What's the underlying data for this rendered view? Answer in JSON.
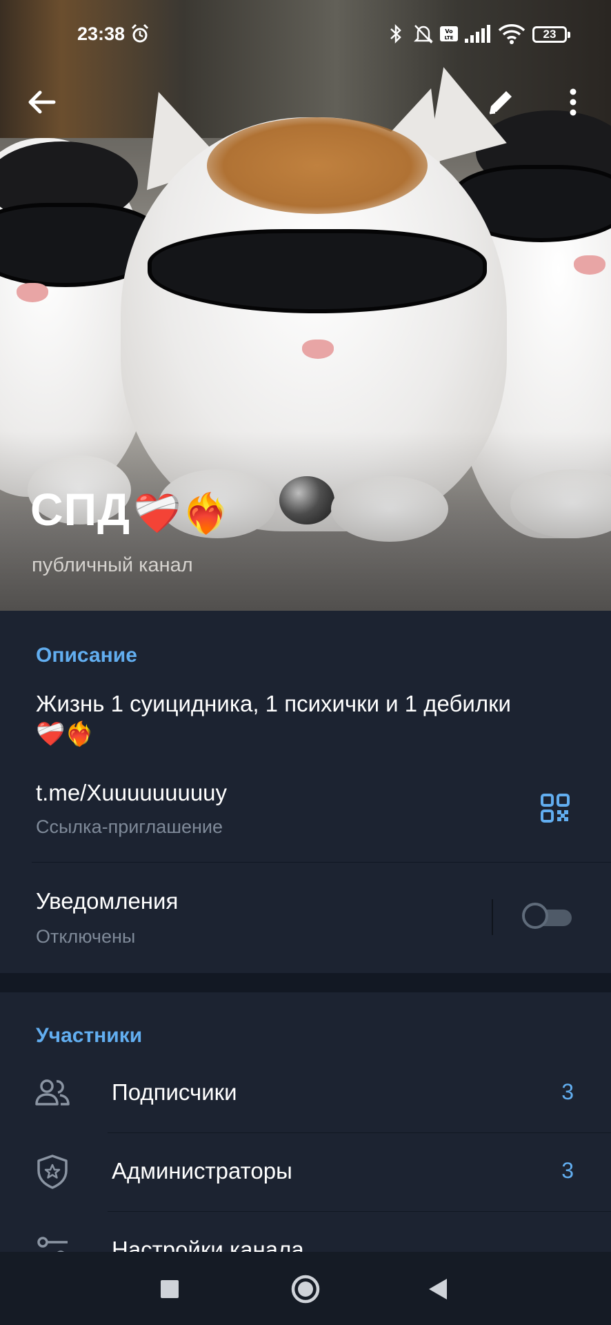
{
  "status_bar": {
    "time": "23:38",
    "alarm_icon": "alarm-clock-icon",
    "battery": "23",
    "icons": [
      "bluetooth-icon",
      "notifications-off-icon",
      "volte-icon",
      "signal-icon",
      "wifi-icon"
    ]
  },
  "toolbar": {
    "back_icon": "arrow-left-icon",
    "edit_icon": "pencil-icon",
    "more_icon": "more-vertical-icon"
  },
  "channel": {
    "name": "СПД",
    "title_emojis": "❤️‍🩹❤️‍🔥",
    "type": "публичный канал"
  },
  "info": {
    "description_label": "Описание",
    "description": "Жизнь 1 суицидника, 1 психички и 1 дебилки",
    "description_emojis": "❤️‍🩹❤️‍🔥",
    "link": "t.me/Xuuuuuuuuuy",
    "link_sub": "Ссылка-приглашение",
    "notifications_label": "Уведомления",
    "notifications_state": "Отключены",
    "notifications_on": false
  },
  "members": {
    "section_label": "Участники",
    "rows": [
      {
        "label": "Подписчики",
        "count": "3",
        "icon": "users-icon"
      },
      {
        "label": "Администраторы",
        "count": "3",
        "icon": "shield-star-icon"
      },
      {
        "label": "Настройки канала",
        "count": "",
        "icon": "settings-sliders-icon"
      }
    ]
  },
  "colors": {
    "accent": "#62aef0",
    "background": "#1c2331",
    "secondary_text": "#7f8a99"
  }
}
